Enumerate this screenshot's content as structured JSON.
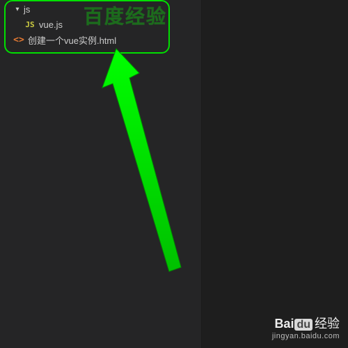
{
  "tree": {
    "folder_js": {
      "label": "js"
    },
    "file_vue": {
      "label": "vue.js",
      "icon_text": "JS"
    },
    "file_html": {
      "label": "创建一个vue实例.html",
      "icon_text": "<>"
    }
  },
  "annotation": {
    "watermark": "百度经验"
  },
  "footer": {
    "brand_left": "Bai",
    "brand_mid": "du",
    "brand_right": "经验",
    "url": "jingyan.baidu.com"
  }
}
